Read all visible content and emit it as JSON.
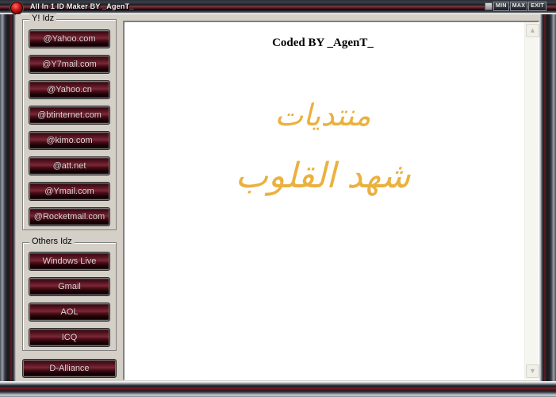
{
  "window": {
    "title": "All In 1 ID Maker BY _AgenT_",
    "controls": {
      "min": "MIN",
      "max": "MAX",
      "exit": "EXIT"
    }
  },
  "sidebar": {
    "yahoo_group": {
      "label": "Y! Idz",
      "buttons": [
        "@Yahoo.com",
        "@Y7mail.com",
        "@Yahoo.cn",
        "@btinternet.com",
        "@kimo.com",
        "@att.net",
        "@Ymail.com",
        "@Rocketmail.com"
      ]
    },
    "others_group": {
      "label": "Others Idz",
      "buttons": [
        "Windows Live",
        "Gmail",
        "AOL",
        "ICQ"
      ]
    },
    "bottom_button": "D-Alliance"
  },
  "content": {
    "credit": "Coded BY _AgenT_",
    "arabic_line1": "منتديات",
    "arabic_line2": "شهد القلوب",
    "arabic_color": "#eab13f"
  },
  "scrollbar": {
    "up_icon": "▲",
    "down_icon": "▼"
  }
}
